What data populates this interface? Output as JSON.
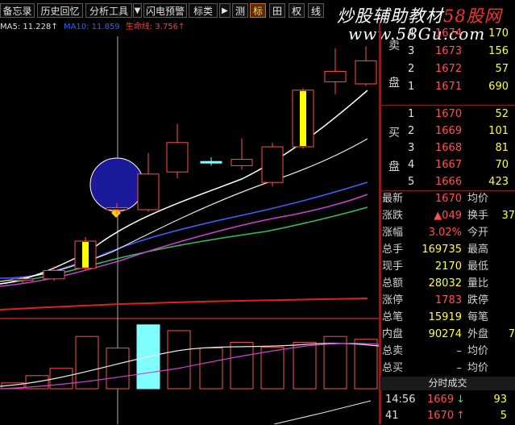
{
  "toolbar": {
    "buttons": [
      "备忘录",
      "历史回忆",
      "分析工具",
      "闪电预警",
      "标类"
    ],
    "play_icon": "▶",
    "tool_icons": [
      "测",
      "标",
      "田",
      "权",
      "线"
    ]
  },
  "watermark": {
    "line1_prefix": "炒股辅助教材",
    "line1_brand": "58股网",
    "line2": "www.58Gu.com"
  },
  "ma_bar": {
    "ma5": "MA5: 11.228↑",
    "ma10": "MA10: 11.859",
    "ma20": "生命线: 3.756↑"
  },
  "colors": {
    "up": "#ff3b3b",
    "down": "#00ffff",
    "price_up": "#ff5050",
    "volume": "#ffff40",
    "label": "#d0d0d0",
    "highlight_yellow": "#ffff00",
    "circle_fill": "#1a1a9a"
  },
  "sell_orders": [
    {
      "level": "4",
      "price": "1674",
      "vol": "170"
    },
    {
      "level": "3",
      "price": "1673",
      "vol": "156"
    },
    {
      "level": "2",
      "price": "1672",
      "vol": "57"
    },
    {
      "level": "1",
      "price": "1671",
      "vol": "690"
    }
  ],
  "sell_label": [
    "卖",
    "盘"
  ],
  "buy_orders": [
    {
      "level": "1",
      "price": "1670",
      "vol": "52"
    },
    {
      "level": "2",
      "price": "1669",
      "vol": "101"
    },
    {
      "level": "3",
      "price": "1668",
      "vol": "81"
    },
    {
      "level": "4",
      "price": "1667",
      "vol": "70"
    },
    {
      "level": "5",
      "price": "1666",
      "vol": "423"
    }
  ],
  "buy_label": [
    "买",
    "盘"
  ],
  "stats": [
    {
      "l1": "最新",
      "v1": "1670",
      "l2": "均价",
      "v2": ""
    },
    {
      "l1": "涨跌",
      "v1": "▲049",
      "l2": "换手",
      "v2": "37"
    },
    {
      "l1": "涨幅",
      "v1": "3.02%",
      "l2": "今开",
      "v2": ""
    },
    {
      "l1": "总手",
      "v1": "169735",
      "l2": "最高",
      "v2": ""
    },
    {
      "l1": "现手",
      "v1": "2170",
      "l2": "最低",
      "v2": ""
    },
    {
      "l1": "总额",
      "v1": "28032",
      "l2": "量比",
      "v2": ""
    },
    {
      "l1": "涨停",
      "v1": "1783",
      "l2": "跌停",
      "v2": ""
    },
    {
      "l1": "总笔",
      "v1": "15919",
      "l2": "每笔",
      "v2": ""
    },
    {
      "l1": "内盘",
      "v1": "90274",
      "l2": "外盘",
      "v2": "7"
    },
    {
      "l1": "总卖",
      "v1": "–",
      "l2": "均价",
      "v2": ""
    },
    {
      "l1": "总买",
      "v1": "–",
      "l2": "均价",
      "v2": ""
    }
  ],
  "ticks_header": "分时成交",
  "ticks": [
    {
      "time": "14:56",
      "price": "1669",
      "arrow": "↓",
      "vol": "93"
    },
    {
      "time": "41",
      "price": "1670",
      "arrow": "↑",
      "vol": "5"
    }
  ],
  "chart_data": {
    "type": "candlestick",
    "candles": [
      {
        "o": 0.12,
        "c": 0.12,
        "h": 0.13,
        "l": 0.1,
        "color": "up"
      },
      {
        "o": 0.16,
        "c": 0.12,
        "h": 0.18,
        "l": 0.11,
        "color": "up"
      },
      {
        "o": 0.3,
        "c": 0.17,
        "h": 0.32,
        "l": 0.16,
        "color": "yellow"
      },
      {
        "o": 0.46,
        "c": 0.45,
        "h": 0.48,
        "l": 0.43,
        "color": "up"
      },
      {
        "o": 0.45,
        "c": 0.62,
        "h": 0.72,
        "l": 0.44,
        "color": "up"
      },
      {
        "o": 0.63,
        "c": 0.77,
        "h": 0.86,
        "l": 0.6,
        "color": "up"
      },
      {
        "o": 0.68,
        "c": 0.68,
        "h": 0.7,
        "l": 0.66,
        "color": "cyan"
      },
      {
        "o": 0.66,
        "c": 0.69,
        "h": 0.79,
        "l": 0.64,
        "color": "up"
      },
      {
        "o": 0.58,
        "c": 0.75,
        "h": 0.77,
        "l": 0.56,
        "color": "up"
      },
      {
        "o": 0.75,
        "c": 1.02,
        "h": 1.03,
        "l": 0.74,
        "color": "yellow"
      },
      {
        "o": 1.06,
        "c": 1.11,
        "h": 1.22,
        "l": 1.0,
        "color": "up"
      },
      {
        "o": 1.05,
        "c": 1.16,
        "h": 1.23,
        "l": 1.04,
        "color": "up"
      },
      {
        "o": 1.12,
        "c": 1.23,
        "h": 1.3,
        "l": 1.1,
        "color": "up"
      }
    ],
    "volumes": [
      0.08,
      0.18,
      0.28,
      0.72,
      0.56,
      0.88,
      0.8,
      0.56,
      0.64,
      0.57,
      0.64,
      0.72,
      0.68,
      0.72,
      0.66
    ]
  }
}
